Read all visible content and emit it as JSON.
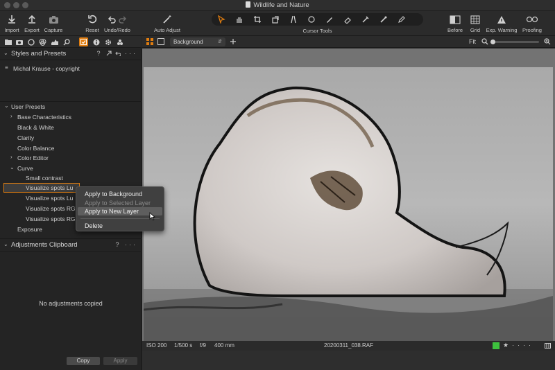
{
  "window": {
    "title": "Wildlife and Nature"
  },
  "toolbar": {
    "import": "Import",
    "export": "Export",
    "capture": "Capture",
    "reset": "Reset",
    "undo_redo": "Undo/Redo",
    "auto_adjust": "Auto Adjust",
    "cursor_tools": "Cursor Tools",
    "before": "Before",
    "grid": "Grid",
    "exp_warning": "Exp. Warning",
    "proofing": "Proofing"
  },
  "styles_panel": {
    "title": "Styles and Presets",
    "help": "?",
    "more": "···",
    "applied_style": "Michal Krause - copyright",
    "user_presets_label": "User Presets",
    "items": [
      "Base Characteristics",
      "Black & White",
      "Clarity",
      "Color Balance",
      "Color Editor",
      "Curve",
      "Small contrast",
      "Visualize spots Lu",
      "Visualize spots Lu",
      "Visualize spots RG",
      "Visualize spots RG",
      "Exposure"
    ]
  },
  "context_menu": {
    "items": [
      "Apply to Background",
      "Apply to Selected Layer",
      "Apply to New Layer",
      "Delete"
    ]
  },
  "clipboard_panel": {
    "title": "Adjustments Clipboard",
    "help": "?",
    "more": "···",
    "empty_text": "No adjustments copied",
    "copy": "Copy",
    "apply": "Apply"
  },
  "viewer": {
    "variant": "Background",
    "zoom_label": "Fit"
  },
  "status": {
    "iso": "ISO 200",
    "shutter": "1/500 s",
    "aperture": "f/9",
    "focal": "400 mm",
    "filename": "20200311_038.RAF",
    "color_tag": "#3ec23e"
  },
  "colors": {
    "accent": "#e07d10"
  }
}
